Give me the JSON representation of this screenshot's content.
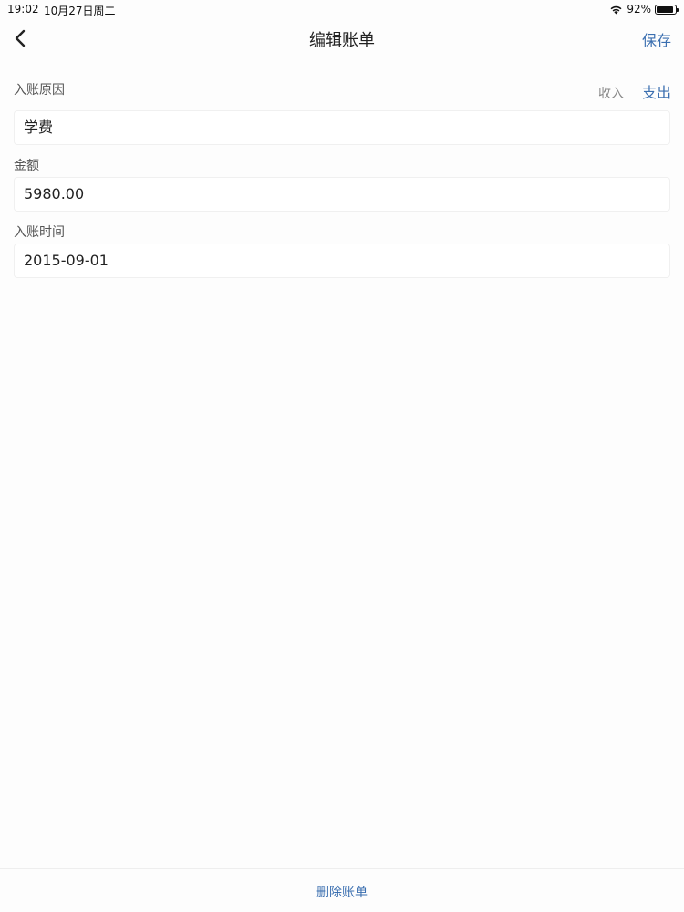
{
  "status_bar": {
    "time": "19:02",
    "date": "10月27日周二",
    "battery_percent": "92%",
    "battery_level": 0.92
  },
  "nav": {
    "title": "编辑账单",
    "save_label": "保存",
    "back_icon": "chevron-left-icon"
  },
  "form": {
    "reason_label": "入账原因",
    "type_options": {
      "income": "收入",
      "expense": "支出"
    },
    "selected_type": "expense",
    "reason_value": "学费",
    "amount_label": "金额",
    "amount_value": "5980.00",
    "time_label": "入账时间",
    "time_value": "2015-09-01"
  },
  "bottom": {
    "delete_label": "删除账单"
  },
  "colors": {
    "accent": "#3b6fb0",
    "muted": "#888888",
    "background": "#fdfdfd"
  }
}
